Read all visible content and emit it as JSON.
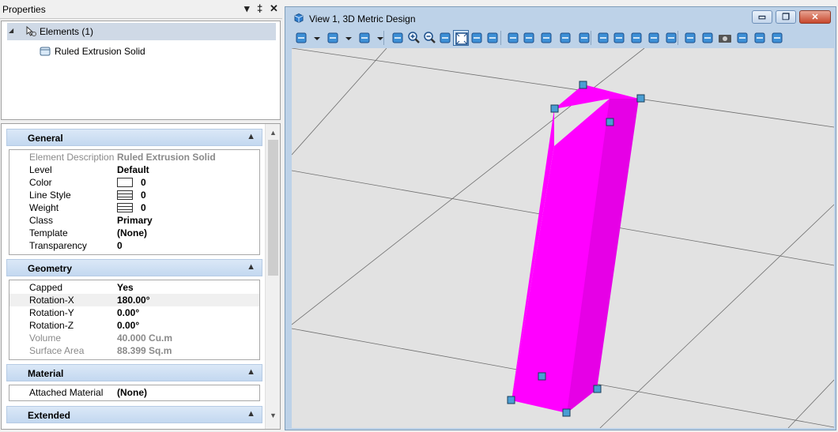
{
  "properties_panel": {
    "title": "Properties",
    "controls": {
      "dropdown": "▾",
      "pin": "‡",
      "close": "✕"
    },
    "tree": {
      "root_label": "Elements (1)",
      "child_label": "Ruled Extrusion Solid"
    },
    "categories": {
      "general": {
        "title": "General",
        "rows": [
          {
            "key": "Element Description",
            "value": "Ruled Extrusion Solid",
            "dim": true
          },
          {
            "key": "Level",
            "value": "Default"
          },
          {
            "key": "Color",
            "value": "0",
            "icon": "color-swatch"
          },
          {
            "key": "Line Style",
            "value": "0",
            "icon": "line-style"
          },
          {
            "key": "Weight",
            "value": "0",
            "icon": "line-weight"
          },
          {
            "key": "Class",
            "value": "Primary"
          },
          {
            "key": "Template",
            "value": "(None)"
          },
          {
            "key": "Transparency",
            "value": "0"
          }
        ]
      },
      "geometry": {
        "title": "Geometry",
        "rows": [
          {
            "key": "Capped",
            "value": "Yes"
          },
          {
            "key": "Rotation-X",
            "value": "180.00°",
            "selected": true
          },
          {
            "key": "Rotation-Y",
            "value": "0.00°"
          },
          {
            "key": "Rotation-Z",
            "value": "0.00°"
          },
          {
            "key": "Volume",
            "value": "40.000 Cu.m",
            "dim": true
          },
          {
            "key": "Surface Area",
            "value": "88.399 Sq.m",
            "dim": true
          }
        ]
      },
      "material": {
        "title": "Material",
        "rows": [
          {
            "key": "Attached Material",
            "value": "(None)"
          }
        ]
      },
      "extended": {
        "title": "Extended"
      }
    }
  },
  "view_window": {
    "title": "View 1, 3D Metric Design",
    "window_controls": {
      "minimize": "▭",
      "restore": "❐",
      "close": "✕"
    },
    "toolbar_icons": [
      "view-attributes-icon",
      "dropdown-arrow-icon",
      "display-style-icon",
      "dropdown-arrow-icon",
      "lighting-icon",
      "dropdown-arrow-icon",
      "update-view-icon",
      "zoom-in-icon",
      "zoom-out-icon",
      "window-area-icon",
      "fit-view-icon",
      "rotate-view-icon",
      "pan-view-icon",
      "walk-icon",
      "view-previous-hand-icon",
      "view-area-icon",
      "previous-view-icon",
      "next-view-icon",
      "view-toggle-icon",
      "clip-volume-icon",
      "clip-mask-icon",
      "set-display-depth-icon",
      "standard-views-icon",
      "set-active-depth-icon",
      "show-depth-icon",
      "camera-icon",
      "view-3d-box-icon",
      "clear-clipping-icon",
      "view-settings-icon"
    ],
    "colors": {
      "solid_front": "#ff00ff",
      "solid_side": "#e600e6",
      "handle_fill": "#4a9ed3",
      "handle_stroke": "#1b3d5a",
      "canvas_bg": "#e2e2e2",
      "grid_line": "#6e6e6e"
    }
  }
}
